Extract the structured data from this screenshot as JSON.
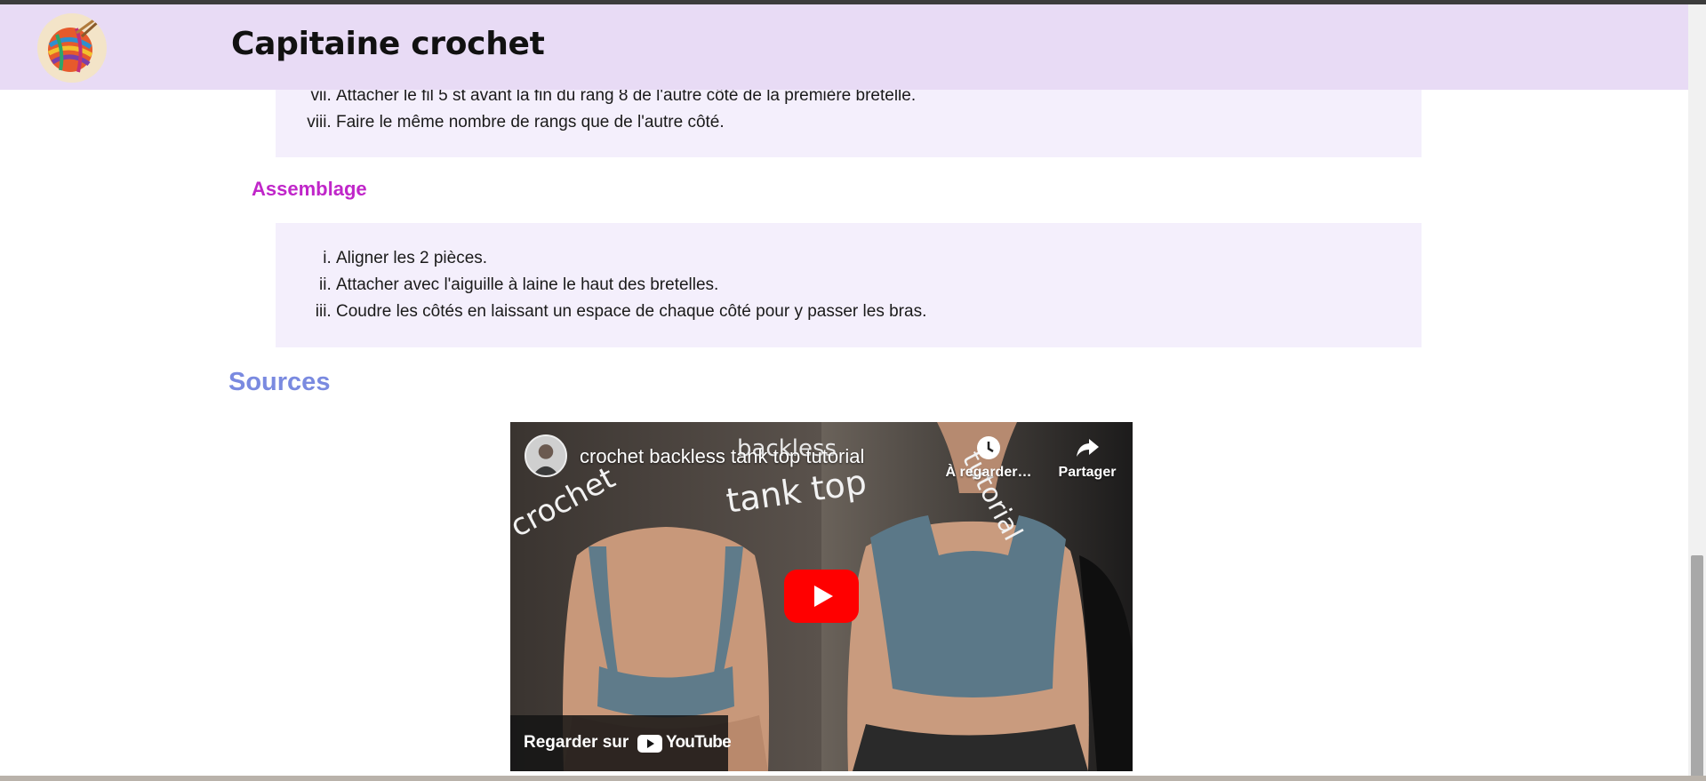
{
  "header": {
    "site_title": "Capitaine crochet",
    "logo_icon": "yarn-ball-logo-icon",
    "background": "#e8dbf5"
  },
  "step_list_top": {
    "start": 7,
    "items": [
      "Attacher le fil 5 st avant la fin du rang 8 de l'autre côté de la première bretelle.",
      "Faire le même nombre de rangs que de l'autre côté."
    ]
  },
  "assemblage": {
    "heading": "Assemblage",
    "heading_color": "#c026c9",
    "items": [
      "Aligner les 2 pièces.",
      "Attacher avec l'aiguille à laine le haut des bretelles.",
      "Coudre les côtés en laissant un espace de chaque côté pour y passer les bras."
    ]
  },
  "sources": {
    "heading": "Sources",
    "heading_color": "#7a8ae0"
  },
  "video": {
    "title": "crochet backless tank top tutorial",
    "watch_later_label": "À regarder…",
    "share_label": "Partager",
    "watch_on_label": "Regarder sur",
    "youtube_wordmark": "YouTube",
    "thumbnail_text": [
      "crochet",
      "backless",
      "tank top",
      "tutorial"
    ],
    "play_button_color": "#ff0000"
  },
  "colors": {
    "box_background": "#f4effc",
    "page_background": "#ffffff"
  }
}
